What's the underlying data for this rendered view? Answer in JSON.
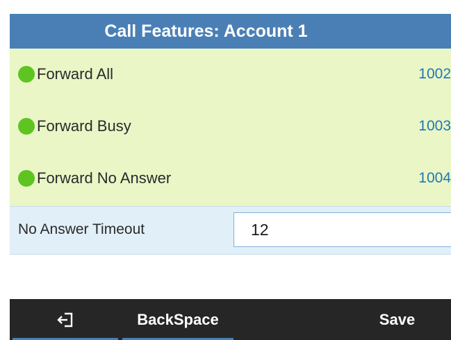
{
  "header": {
    "title": "Call Features: Account  1"
  },
  "features": [
    {
      "label": "Forward All",
      "value": "1002",
      "status_color": "#5ec422"
    },
    {
      "label": "Forward Busy",
      "value": "1003",
      "status_color": "#5ec422"
    },
    {
      "label": "Forward No Answer",
      "value": "1004",
      "status_color": "#5ec422"
    }
  ],
  "timeout": {
    "label": "No Answer Timeout",
    "value": "12"
  },
  "softkeys": {
    "exit_icon": "exit-icon",
    "backspace_label": "BackSpace",
    "save_label": "Save"
  },
  "colors": {
    "header_bg": "#4a7fb6",
    "list_bg": "#eaf6c6",
    "value_text": "#1e78b4",
    "softkey_bg": "#262626"
  }
}
